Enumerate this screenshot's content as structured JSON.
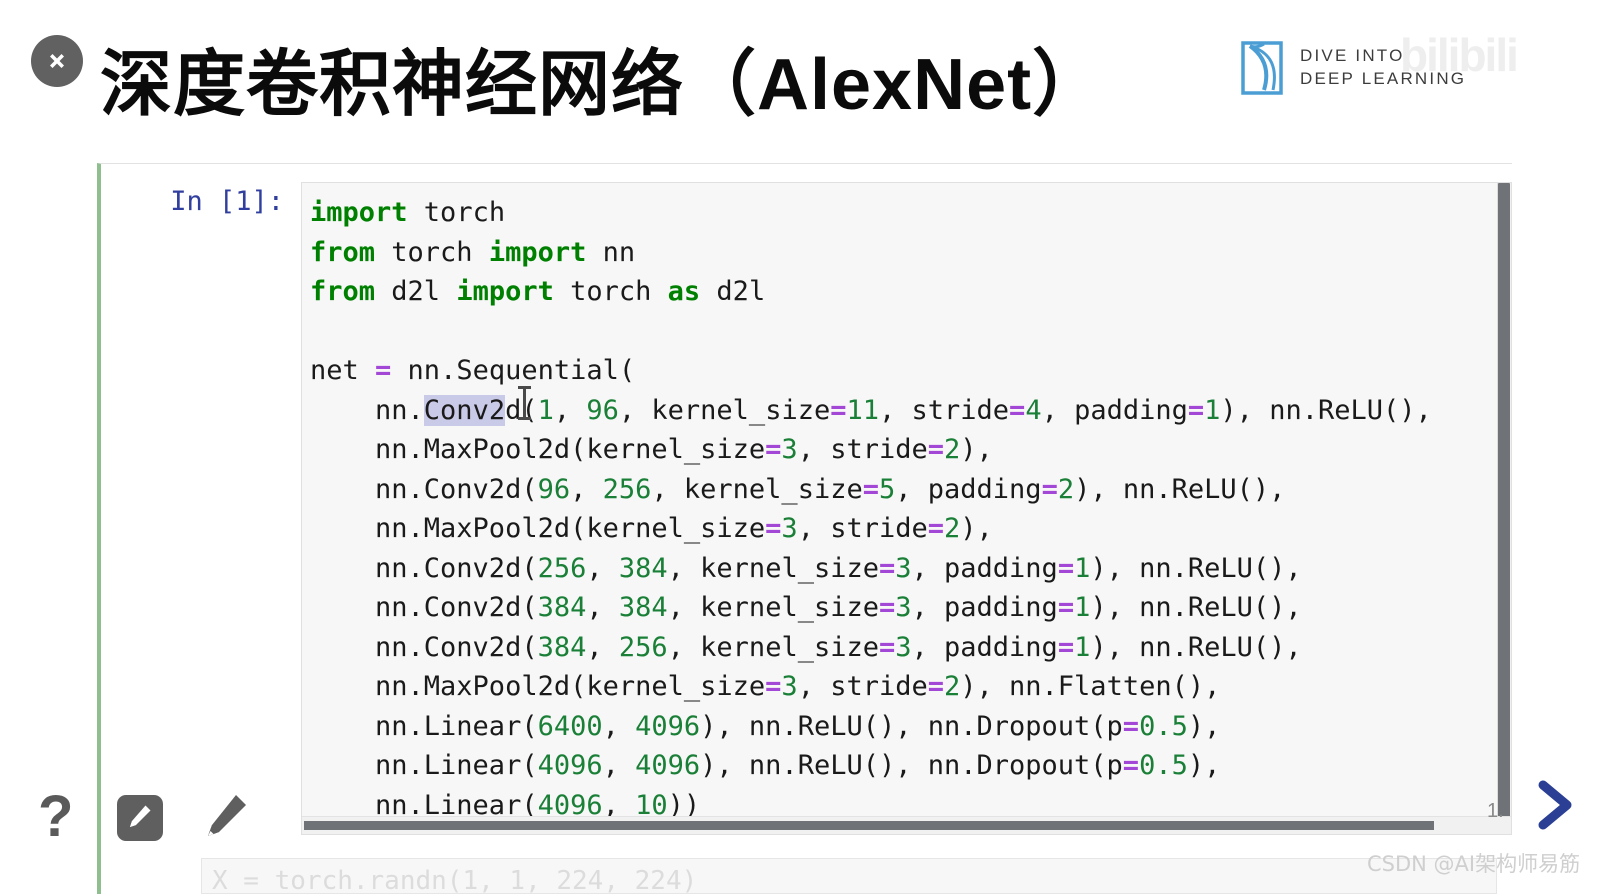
{
  "slide": {
    "title_cn": "深度卷积神经网络",
    "title_latin": "（AlexNet）",
    "close_icon": "close-icon"
  },
  "logo": {
    "mark": "book-icon",
    "line1": "DIVE INTO",
    "line2": "DEEP LEARNING",
    "watermark": "bilibili"
  },
  "notebook": {
    "prompt": "In [1]:",
    "code_lines": [
      [
        {
          "t": "import",
          "c": "k"
        },
        {
          "t": " torch",
          "c": ""
        }
      ],
      [
        {
          "t": "from",
          "c": "k"
        },
        {
          "t": " torch ",
          "c": ""
        },
        {
          "t": "import",
          "c": "k"
        },
        {
          "t": " nn",
          "c": ""
        }
      ],
      [
        {
          "t": "from",
          "c": "k"
        },
        {
          "t": " d2l ",
          "c": ""
        },
        {
          "t": "import",
          "c": "k"
        },
        {
          "t": " torch ",
          "c": ""
        },
        {
          "t": "as",
          "c": "k"
        },
        {
          "t": " d2l",
          "c": ""
        }
      ],
      [],
      [
        {
          "t": "net ",
          "c": ""
        },
        {
          "t": "=",
          "c": "op"
        },
        {
          "t": " nn.Sequential(",
          "c": ""
        }
      ],
      [
        {
          "t": "    nn.",
          "c": ""
        },
        {
          "t": "Conv2",
          "c": "sel"
        },
        {
          "t": "d(",
          "c": ""
        },
        {
          "t": "1",
          "c": "n"
        },
        {
          "t": ", ",
          "c": ""
        },
        {
          "t": "96",
          "c": "n"
        },
        {
          "t": ", kernel_size",
          "c": ""
        },
        {
          "t": "=",
          "c": "op"
        },
        {
          "t": "11",
          "c": "n"
        },
        {
          "t": ", stride",
          "c": ""
        },
        {
          "t": "=",
          "c": "op"
        },
        {
          "t": "4",
          "c": "n"
        },
        {
          "t": ", padding",
          "c": ""
        },
        {
          "t": "=",
          "c": "op"
        },
        {
          "t": "1",
          "c": "n"
        },
        {
          "t": "), nn.ReLU(),",
          "c": ""
        }
      ],
      [
        {
          "t": "    nn.MaxPool2d(kernel_size",
          "c": ""
        },
        {
          "t": "=",
          "c": "op"
        },
        {
          "t": "3",
          "c": "n"
        },
        {
          "t": ", stride",
          "c": ""
        },
        {
          "t": "=",
          "c": "op"
        },
        {
          "t": "2",
          "c": "n"
        },
        {
          "t": "),",
          "c": ""
        }
      ],
      [
        {
          "t": "    nn.Conv2d(",
          "c": ""
        },
        {
          "t": "96",
          "c": "n"
        },
        {
          "t": ", ",
          "c": ""
        },
        {
          "t": "256",
          "c": "n"
        },
        {
          "t": ", kernel_size",
          "c": ""
        },
        {
          "t": "=",
          "c": "op"
        },
        {
          "t": "5",
          "c": "n"
        },
        {
          "t": ", padding",
          "c": ""
        },
        {
          "t": "=",
          "c": "op"
        },
        {
          "t": "2",
          "c": "n"
        },
        {
          "t": "), nn.ReLU(),",
          "c": ""
        }
      ],
      [
        {
          "t": "    nn.MaxPool2d(kernel_size",
          "c": ""
        },
        {
          "t": "=",
          "c": "op"
        },
        {
          "t": "3",
          "c": "n"
        },
        {
          "t": ", stride",
          "c": ""
        },
        {
          "t": "=",
          "c": "op"
        },
        {
          "t": "2",
          "c": "n"
        },
        {
          "t": "),",
          "c": ""
        }
      ],
      [
        {
          "t": "    nn.Conv2d(",
          "c": ""
        },
        {
          "t": "256",
          "c": "n"
        },
        {
          "t": ", ",
          "c": ""
        },
        {
          "t": "384",
          "c": "n"
        },
        {
          "t": ", kernel_size",
          "c": ""
        },
        {
          "t": "=",
          "c": "op"
        },
        {
          "t": "3",
          "c": "n"
        },
        {
          "t": ", padding",
          "c": ""
        },
        {
          "t": "=",
          "c": "op"
        },
        {
          "t": "1",
          "c": "n"
        },
        {
          "t": "), nn.ReLU(),",
          "c": ""
        }
      ],
      [
        {
          "t": "    nn.Conv2d(",
          "c": ""
        },
        {
          "t": "384",
          "c": "n"
        },
        {
          "t": ", ",
          "c": ""
        },
        {
          "t": "384",
          "c": "n"
        },
        {
          "t": ", kernel_size",
          "c": ""
        },
        {
          "t": "=",
          "c": "op"
        },
        {
          "t": "3",
          "c": "n"
        },
        {
          "t": ", padding",
          "c": ""
        },
        {
          "t": "=",
          "c": "op"
        },
        {
          "t": "1",
          "c": "n"
        },
        {
          "t": "), nn.ReLU(),",
          "c": ""
        }
      ],
      [
        {
          "t": "    nn.Conv2d(",
          "c": ""
        },
        {
          "t": "384",
          "c": "n"
        },
        {
          "t": ", ",
          "c": ""
        },
        {
          "t": "256",
          "c": "n"
        },
        {
          "t": ", kernel_size",
          "c": ""
        },
        {
          "t": "=",
          "c": "op"
        },
        {
          "t": "3",
          "c": "n"
        },
        {
          "t": ", padding",
          "c": ""
        },
        {
          "t": "=",
          "c": "op"
        },
        {
          "t": "1",
          "c": "n"
        },
        {
          "t": "), nn.ReLU(),",
          "c": ""
        }
      ],
      [
        {
          "t": "    nn.MaxPool2d(kernel_size",
          "c": ""
        },
        {
          "t": "=",
          "c": "op"
        },
        {
          "t": "3",
          "c": "n"
        },
        {
          "t": ", stride",
          "c": ""
        },
        {
          "t": "=",
          "c": "op"
        },
        {
          "t": "2",
          "c": "n"
        },
        {
          "t": "), nn.Flatten(),",
          "c": ""
        }
      ],
      [
        {
          "t": "    nn.Linear(",
          "c": ""
        },
        {
          "t": "6400",
          "c": "n"
        },
        {
          "t": ", ",
          "c": ""
        },
        {
          "t": "4096",
          "c": "n"
        },
        {
          "t": "), nn.ReLU(), nn.Dropout(p",
          "c": ""
        },
        {
          "t": "=",
          "c": "op"
        },
        {
          "t": "0.5",
          "c": "n"
        },
        {
          "t": "),",
          "c": ""
        }
      ],
      [
        {
          "t": "    nn.Linear(",
          "c": ""
        },
        {
          "t": "4096",
          "c": "n"
        },
        {
          "t": ", ",
          "c": ""
        },
        {
          "t": "4096",
          "c": "n"
        },
        {
          "t": "), nn.ReLU(), nn.Dropout(p",
          "c": ""
        },
        {
          "t": "=",
          "c": "op"
        },
        {
          "t": "0.5",
          "c": "n"
        },
        {
          "t": "),",
          "c": ""
        }
      ],
      [
        {
          "t": "    nn.Linear(",
          "c": ""
        },
        {
          "t": "4096",
          "c": "n"
        },
        {
          "t": ", ",
          "c": ""
        },
        {
          "t": "10",
          "c": "n"
        },
        {
          "t": "))",
          "c": ""
        }
      ]
    ],
    "next_cell_preview": "X = torch.randn(1, 1, 224, 224)"
  },
  "toolbar": {
    "help_label": "?",
    "pen_button_icon": "pencil-icon",
    "pen_plain_icon": "pencil-icon"
  },
  "footer": {
    "page_indicator": "1.",
    "next_arrow_icon": "chevron-right-icon",
    "watermark": "CSDN @AI架构师易筋"
  },
  "colors": {
    "accent_green": "#8fbf8f",
    "keyword_green": "#008000",
    "number_green": "#1a7f37",
    "operator_purple": "#a347d6",
    "prompt_blue": "#303f9f",
    "logo_blue": "#4a9ed4",
    "arrow_blue": "#2b3f94",
    "selection": "#c9c9e8"
  }
}
